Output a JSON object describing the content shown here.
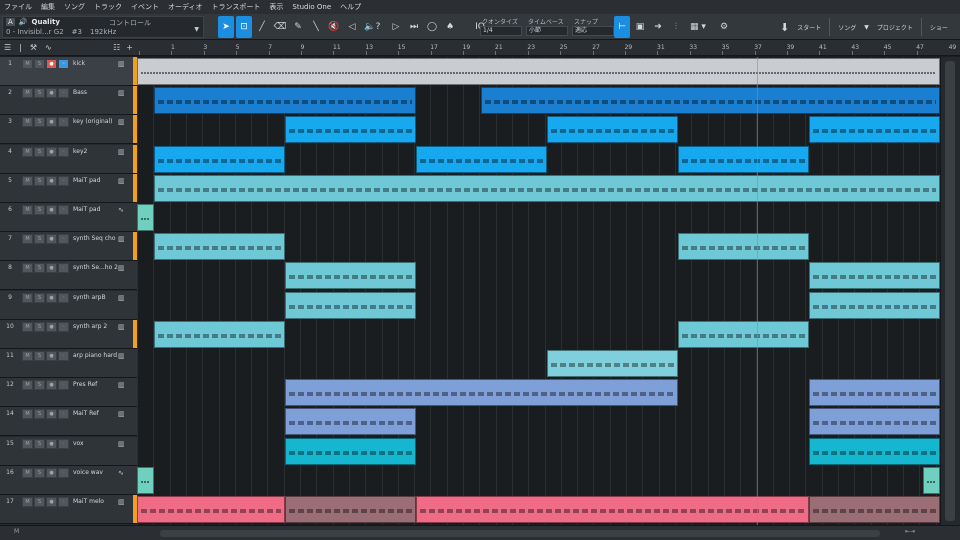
{
  "menu": [
    "ファイル",
    "編集",
    "ソング",
    "トラック",
    "イベント",
    "オーディオ",
    "トランスポート",
    "表示",
    "Studio One",
    "ヘルプ"
  ],
  "info": {
    "badge": "A",
    "title": "Quality",
    "control_label": "コントロール",
    "song": "0 - Invisibl...r G2",
    "preset": "#3",
    "rate": "192kHz"
  },
  "quantize": {
    "quantize_label": "クオンタイズ",
    "quantize_value": "1/4",
    "timebase_label": "タイムベース",
    "timebase_value": "小節",
    "snap_label": "スナップ",
    "snap_value": "適応"
  },
  "nav": {
    "start": "スタート",
    "song": "ソング",
    "project": "プロジェクト",
    "show": "ショー"
  },
  "ruler_numbers": [
    "1",
    "3",
    "5",
    "7",
    "9",
    "11",
    "13",
    "15",
    "17",
    "19",
    "21",
    "23",
    "25",
    "27",
    "29",
    "31",
    "33",
    "35",
    "37",
    "39",
    "41",
    "43",
    "45",
    "47",
    "49"
  ],
  "tracks": [
    {
      "num": "1",
      "name": "kick",
      "type": "instrument",
      "strip": "#f0a020"
    },
    {
      "num": "2",
      "name": "Bass",
      "type": "instrument",
      "strip": "#f0a020"
    },
    {
      "num": "3",
      "name": "key (original)",
      "type": "instrument",
      "strip": "#f0a020"
    },
    {
      "num": "4",
      "name": "key2",
      "type": "instrument",
      "strip": "#f0a020"
    },
    {
      "num": "5",
      "name": "MaiT pad",
      "type": "instrument",
      "strip": "#f0a020"
    },
    {
      "num": "6",
      "name": "MaiT pad",
      "type": "audio",
      "strip": ""
    },
    {
      "num": "7",
      "name": "synth Seq cho",
      "type": "instrument",
      "strip": "#f0a020"
    },
    {
      "num": "8",
      "name": "synth Se...ho 2",
      "type": "instrument",
      "strip": ""
    },
    {
      "num": "9",
      "name": "synth arpB",
      "type": "instrument",
      "strip": ""
    },
    {
      "num": "10",
      "name": "synth arp 2",
      "type": "instrument",
      "strip": "#f0a020"
    },
    {
      "num": "11",
      "name": "arp piano hard",
      "type": "instrument",
      "strip": ""
    },
    {
      "num": "12",
      "name": "Pres Ref",
      "type": "instrument",
      "strip": ""
    },
    {
      "num": "14",
      "name": "MaiT Ref",
      "type": "instrument",
      "strip": ""
    },
    {
      "num": "15",
      "name": "vox",
      "type": "instrument",
      "strip": ""
    },
    {
      "num": "16",
      "name": "voice wav",
      "type": "audio",
      "strip": ""
    },
    {
      "num": "17",
      "name": "MaiT melo",
      "type": "instrument",
      "strip": "#f0a020"
    }
  ],
  "colors": {
    "kick": "#c9cdd1",
    "bass": "#1a7fd0",
    "key": "#17a9ef",
    "pad": "#6fc8d6",
    "arp_piano": "#7fd0dc",
    "pres_ref": "#7f9fd8",
    "vox": "#15b7d0",
    "melo": "#ef6b86",
    "melo_dim": "#9a6e74",
    "audio": "#6fd0c0"
  }
}
